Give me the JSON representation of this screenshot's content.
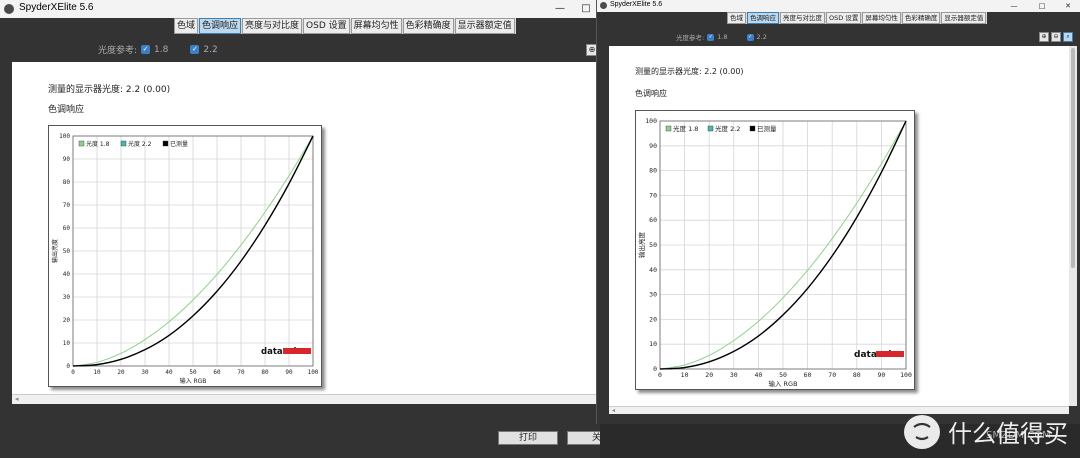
{
  "app": {
    "title": "SpyderXElite 5.6",
    "window_buttons": {
      "minimize": "—",
      "maximize": "□",
      "close": "✕"
    }
  },
  "tabs": [
    "色域",
    "色调响应",
    "亮度与对比度",
    "OSD 设置",
    "屏幕均匀性",
    "色彩精确度",
    "显示器额定值"
  ],
  "active_tab": "色调响应",
  "reference": {
    "label": "光度参考:",
    "options": [
      {
        "label": "1.8",
        "checked": true
      },
      {
        "label": "2.2",
        "checked": true
      }
    ]
  },
  "measured_text": "测量的显示器光度:  2.2 (0.00)",
  "section_title": "色调响应",
  "chart_data": {
    "type": "line",
    "xlabel": "输入 RGB",
    "ylabel": "输出亮度",
    "xlim": [
      0,
      100
    ],
    "ylim": [
      0,
      100
    ],
    "xticks": [
      "0",
      "10",
      "20",
      "30",
      "40",
      "50",
      "60",
      "70",
      "80",
      "90",
      "100"
    ],
    "yticks": [
      "0",
      "10",
      "20",
      "30",
      "40",
      "50",
      "60",
      "70",
      "80",
      "90",
      "100"
    ],
    "grid": true,
    "legend_placement": "top-left",
    "brand": "datacolor",
    "series": [
      {
        "name": "光度 1.8",
        "color": "#8ed08e",
        "x": [
          0,
          10,
          20,
          30,
          40,
          50,
          60,
          70,
          80,
          90,
          100
        ],
        "y": [
          0,
          1.6,
          5.5,
          11.5,
          19.2,
          28.7,
          39.8,
          52.6,
          66.9,
          82.7,
          100
        ]
      },
      {
        "name": "光度 2.2",
        "color": "#49b6b0",
        "x": [
          0,
          10,
          20,
          30,
          40,
          50,
          60,
          70,
          80,
          90,
          100
        ],
        "y": [
          0,
          0.6,
          2.9,
          7.1,
          13.3,
          21.8,
          32.5,
          45.6,
          61.2,
          79.3,
          100
        ]
      },
      {
        "name": "已测量",
        "color": "#000000",
        "x": [
          0,
          10,
          20,
          30,
          40,
          50,
          60,
          70,
          80,
          90,
          100
        ],
        "y": [
          0,
          0.6,
          2.9,
          7.1,
          13.3,
          21.8,
          32.5,
          45.6,
          61.2,
          79.3,
          100
        ]
      }
    ]
  },
  "buttons": {
    "print": "打印",
    "close": "关"
  },
  "watermark": {
    "text": "什么值得买",
    "sub": "SMZDM.COM"
  }
}
